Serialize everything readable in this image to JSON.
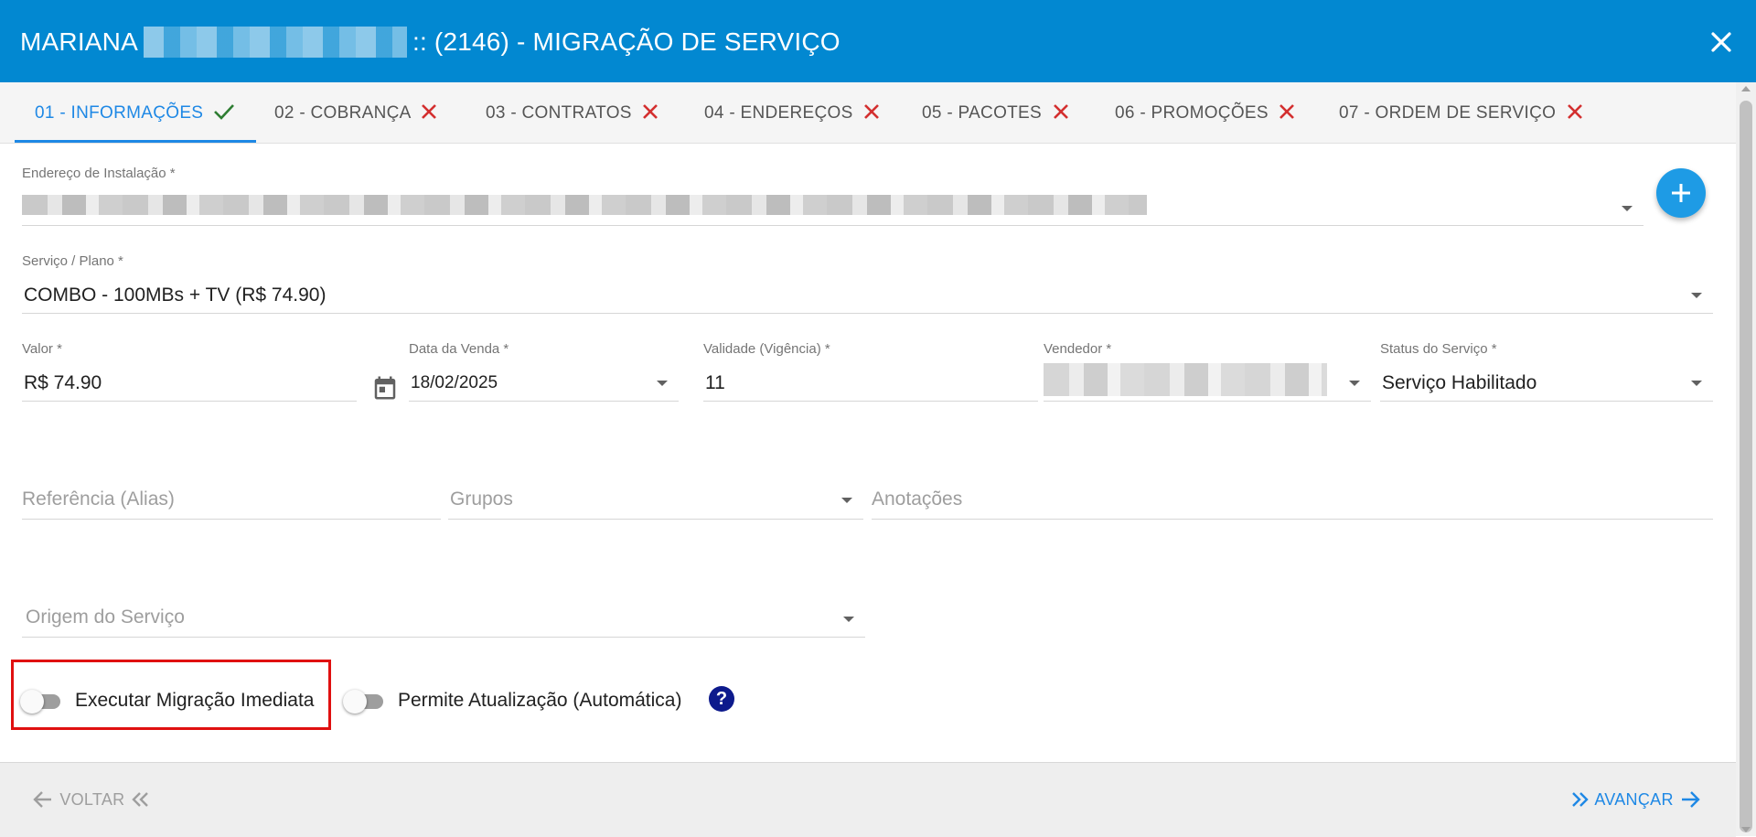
{
  "header": {
    "title_prefix": "MARIANA",
    "title_suffix": ":: (2146) - MIGRAÇÃO DE SERVIÇO"
  },
  "tabs": [
    {
      "label": "01 - INFORMAÇÕES",
      "status": "complete"
    },
    {
      "label": "02 - COBRANÇA",
      "status": "incomplete"
    },
    {
      "label": "03 - CONTRATOS",
      "status": "incomplete"
    },
    {
      "label": "04 - ENDEREÇOS",
      "status": "incomplete"
    },
    {
      "label": "05 - PACOTES",
      "status": "incomplete"
    },
    {
      "label": "06 - PROMOÇÕES",
      "status": "incomplete"
    },
    {
      "label": "07 - ORDEM DE SERVIÇO",
      "status": "incomplete"
    }
  ],
  "form": {
    "endereco": {
      "label": "Endereço de Instalação *"
    },
    "servico": {
      "label": "Serviço / Plano *",
      "value": "COMBO - 100MBs + TV (R$ 74.90)"
    },
    "valor": {
      "label": "Valor *",
      "value": "R$ 74.90"
    },
    "data_venda": {
      "label": "Data da Venda *",
      "value": "18/02/2025"
    },
    "validade": {
      "label": "Validade (Vigência) *",
      "value": "11"
    },
    "vendedor": {
      "label": "Vendedor *"
    },
    "status": {
      "label": "Status do Serviço *",
      "value": "Serviço Habilitado"
    },
    "referencia": {
      "placeholder": "Referência (Alias)"
    },
    "grupos": {
      "placeholder": "Grupos"
    },
    "anotacoes": {
      "placeholder": "Anotações"
    },
    "origem": {
      "placeholder": "Origem do Serviço"
    }
  },
  "toggles": {
    "executar": {
      "label": "Executar Migração Imediata",
      "on": false
    },
    "permite": {
      "label": "Permite Atualização (Automática)",
      "on": false
    }
  },
  "help": {
    "glyph": "?"
  },
  "footer": {
    "back_label": "VOLTAR",
    "next_label": "AVANÇAR"
  },
  "colors": {
    "header": "#0288d1",
    "accent": "#1e88e5",
    "complete": "#2e7d32",
    "incomplete": "#d32f2f",
    "highlight": "#e01010"
  },
  "icons": {
    "close": "close-icon",
    "check": "check-icon",
    "cross": "x-icon",
    "add": "plus-icon",
    "calendar": "calendar-icon",
    "help": "question-icon",
    "back": "arrow-left-icon",
    "next": "arrow-right-icon"
  }
}
